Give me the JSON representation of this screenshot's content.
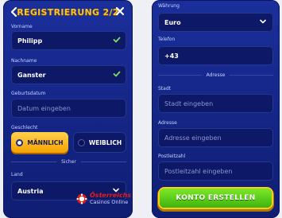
{
  "left_panel": {
    "title": "REGISTRIERUNG 2/2",
    "fields": {
      "first_name": {
        "label": "Vorname",
        "value": "Philipp"
      },
      "last_name": {
        "label": "Nachname",
        "value": "Ganster"
      },
      "birthdate": {
        "label": "Geburtsdatum",
        "placeholder": "Datum eingeben"
      }
    },
    "gender": {
      "label": "Geschlecht",
      "male": "MÄNNLICH",
      "female": "WEIBLICH"
    },
    "divider": "Sicher",
    "country": {
      "label": "Land",
      "value": "Austria"
    }
  },
  "right_panel": {
    "currency": {
      "label": "Währung",
      "value": "Euro"
    },
    "phone": {
      "label": "Telefon",
      "value": "+43"
    },
    "divider": "Adresse",
    "city": {
      "label": "Stadt",
      "placeholder": "Stadt eingeben"
    },
    "address": {
      "label": "Adresse",
      "placeholder": "Adresse eingeben"
    },
    "postcode": {
      "label": "Postleitzahl",
      "placeholder": "Postleitzahl eingeben"
    },
    "create_button": "KONTO ERSTELLEN"
  },
  "watermark": {
    "line1": "Österreichs",
    "line2": "Casinos Online"
  },
  "colors": {
    "title_yellow": "#ffc51a",
    "panel_blue": "#1b2f9c",
    "button_green": "#4cc21a",
    "valid_check": "#7ee05a"
  }
}
